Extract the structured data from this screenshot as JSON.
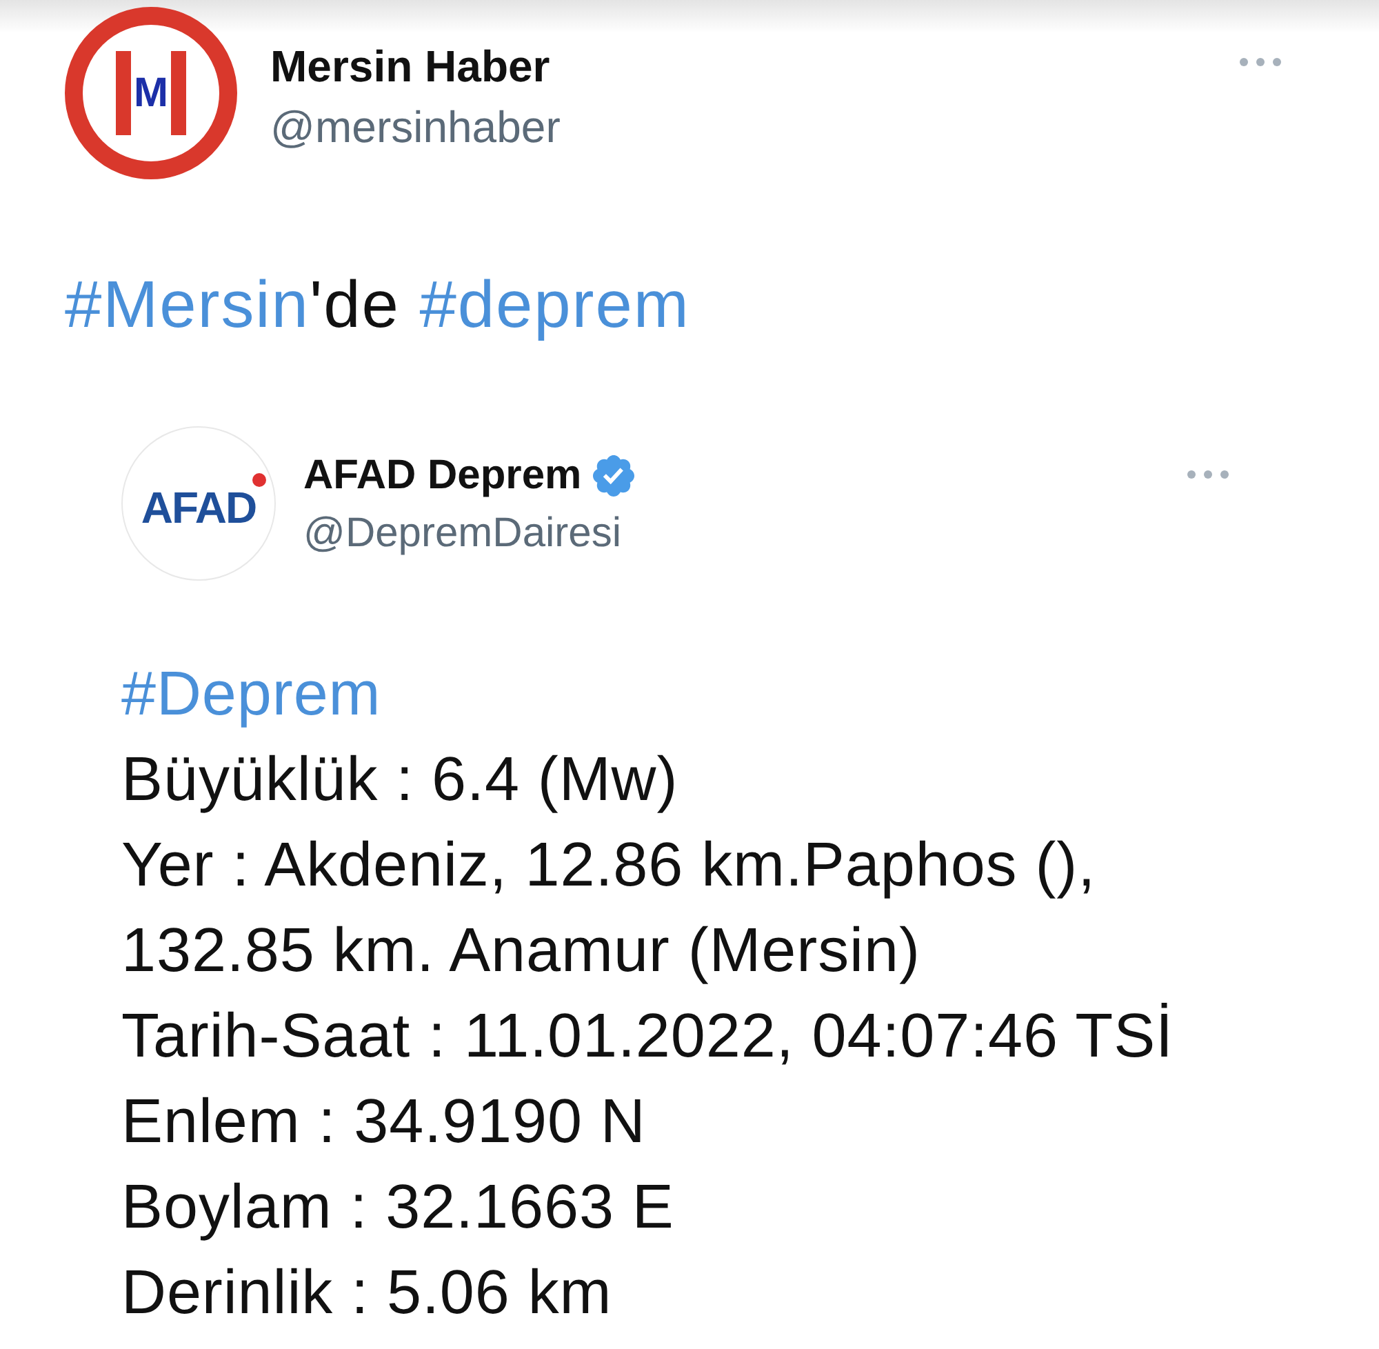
{
  "tweet": {
    "author": {
      "name": "Mersin Haber",
      "handle": "@mersinhaber",
      "logo_text": "M"
    },
    "text": [
      {
        "kind": "hashtag",
        "text": "#Mersin"
      },
      {
        "kind": "plain",
        "text": "'de "
      },
      {
        "kind": "hashtag",
        "text": "#deprem"
      }
    ],
    "quoted_tweet": {
      "author": {
        "name": "AFAD Deprem",
        "handle": "@DepremDairesi",
        "verified": true,
        "logo_text": "AFAD"
      },
      "lines": [
        {
          "kind": "hashtag",
          "text": "#Deprem"
        },
        {
          "kind": "plain",
          "text": "Büyüklük : 6.4 (Mw)"
        },
        {
          "kind": "plain",
          "text": "Yer : Akdeniz, 12.86 km.Paphos (), 132.85 km. Anamur (Mersin)"
        },
        {
          "kind": "plain",
          "text": "Tarih-Saat : 11.01.2022, 04:07:46 TSİ"
        },
        {
          "kind": "plain",
          "text": "Enlem : 34.9190 N"
        },
        {
          "kind": "plain",
          "text": "Boylam : 32.1663 E"
        },
        {
          "kind": "plain",
          "text": "Derinlik : 5.06 km"
        }
      ]
    }
  }
}
